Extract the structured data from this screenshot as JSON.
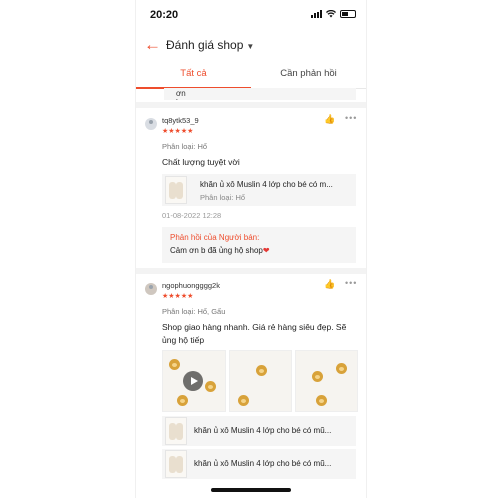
{
  "status_bar": {
    "time": "20:20"
  },
  "header": {
    "title": "Đánh giá shop"
  },
  "tabs": [
    {
      "label": "Tất cả"
    },
    {
      "label": "Cần phản hồi"
    }
  ],
  "prev_reply": {
    "text": "Cảm ơn bạn đã ủng hộ shop"
  },
  "reviews": [
    {
      "username": "tq8ytk53_9",
      "stars": "★★★★★",
      "variant": "Phân loại: Hổ",
      "comment": "Chất lượng tuyệt vời",
      "product": {
        "name": "khăn ủ xô Muslin 4 lớp cho bé có m...",
        "variant": "Phân loại: Hổ"
      },
      "date": "01-08-2022 12:28",
      "reply": {
        "label": "Phản hồi của Người bán:",
        "text": "Cảm ơn b đã ủng hộ shop"
      }
    },
    {
      "username": "ngophuongggg2k",
      "stars": "★★★★★",
      "variant": "Phân loại: Hổ, Gấu",
      "comment_line1": "Shop giao hàng nhanh. Giá rẻ hàng siêu đẹp. Sẽ",
      "comment_line2": "ủng hộ tiếp",
      "products": [
        {
          "name": "khăn ủ xô Muslin 4 lớp cho bé có mũ..."
        },
        {
          "name": "khăn ủ xô Muslin 4 lớp cho bé có mũ..."
        }
      ]
    }
  ],
  "icons": {
    "back": "arrow-left-icon",
    "like": "thumbs-up-icon",
    "more": "more-dots-icon",
    "play": "play-icon"
  },
  "colors": {
    "accent": "#ee4d2d",
    "heart": "#e53935"
  }
}
